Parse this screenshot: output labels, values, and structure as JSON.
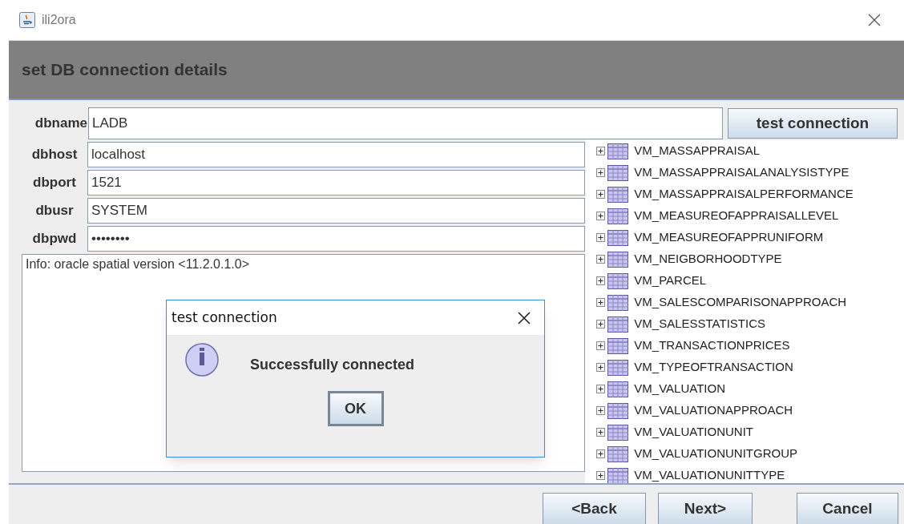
{
  "window": {
    "title": "ili2ora"
  },
  "header": {
    "title": "set DB connection details"
  },
  "fields": [
    {
      "label": "dbname",
      "value": "LADB"
    },
    {
      "label": "dbhost",
      "value": "localhost"
    },
    {
      "label": "dbport",
      "value": "1521"
    },
    {
      "label": "dbusr",
      "value": "SYSTEM"
    },
    {
      "label": "dbpwd",
      "value": "••••••••"
    }
  ],
  "test_button": "test connection",
  "info_text": "Info: oracle spatial version <11.2.0.1.0>",
  "tree": {
    "items": [
      {
        "label": "VM_MASSAPPRAISAL",
        "expanded": false
      },
      {
        "label": "VM_MASSAPPRAISALANALYSISTYPE",
        "expanded": false
      },
      {
        "label": "VM_MASSAPPRAISALPERFORMANCE",
        "expanded": false
      },
      {
        "label": "VM_MEASUREOFAPPRAISALLEVEL",
        "expanded": false
      },
      {
        "label": "VM_MEASUREOFAPPRUNIFORM",
        "expanded": false
      },
      {
        "label": "VM_NEIGBORHOODTYPE",
        "expanded": false
      },
      {
        "label": "VM_PARCEL",
        "expanded": false
      },
      {
        "label": "VM_SALESCOMPARISONAPPROACH",
        "expanded": false
      },
      {
        "label": "VM_SALESSTATISTICS",
        "expanded": false
      },
      {
        "label": "VM_TRANSACTIONPRICES",
        "expanded": false
      },
      {
        "label": "VM_TYPEOFTRANSACTION",
        "expanded": false
      },
      {
        "label": "VM_VALUATION",
        "expanded": false
      },
      {
        "label": "VM_VALUATIONAPPROACH",
        "expanded": false
      },
      {
        "label": "VM_VALUATIONUNIT",
        "expanded": false
      },
      {
        "label": "VM_VALUATIONUNITGROUP",
        "expanded": false
      },
      {
        "label": "VM_VALUATIONUNITTYPE",
        "expanded": false
      }
    ]
  },
  "buttons": [
    "<Back",
    "Next>",
    "Cancel"
  ],
  "dialog": {
    "title": "test connection",
    "message": "Successfully connected",
    "button": "OK"
  }
}
